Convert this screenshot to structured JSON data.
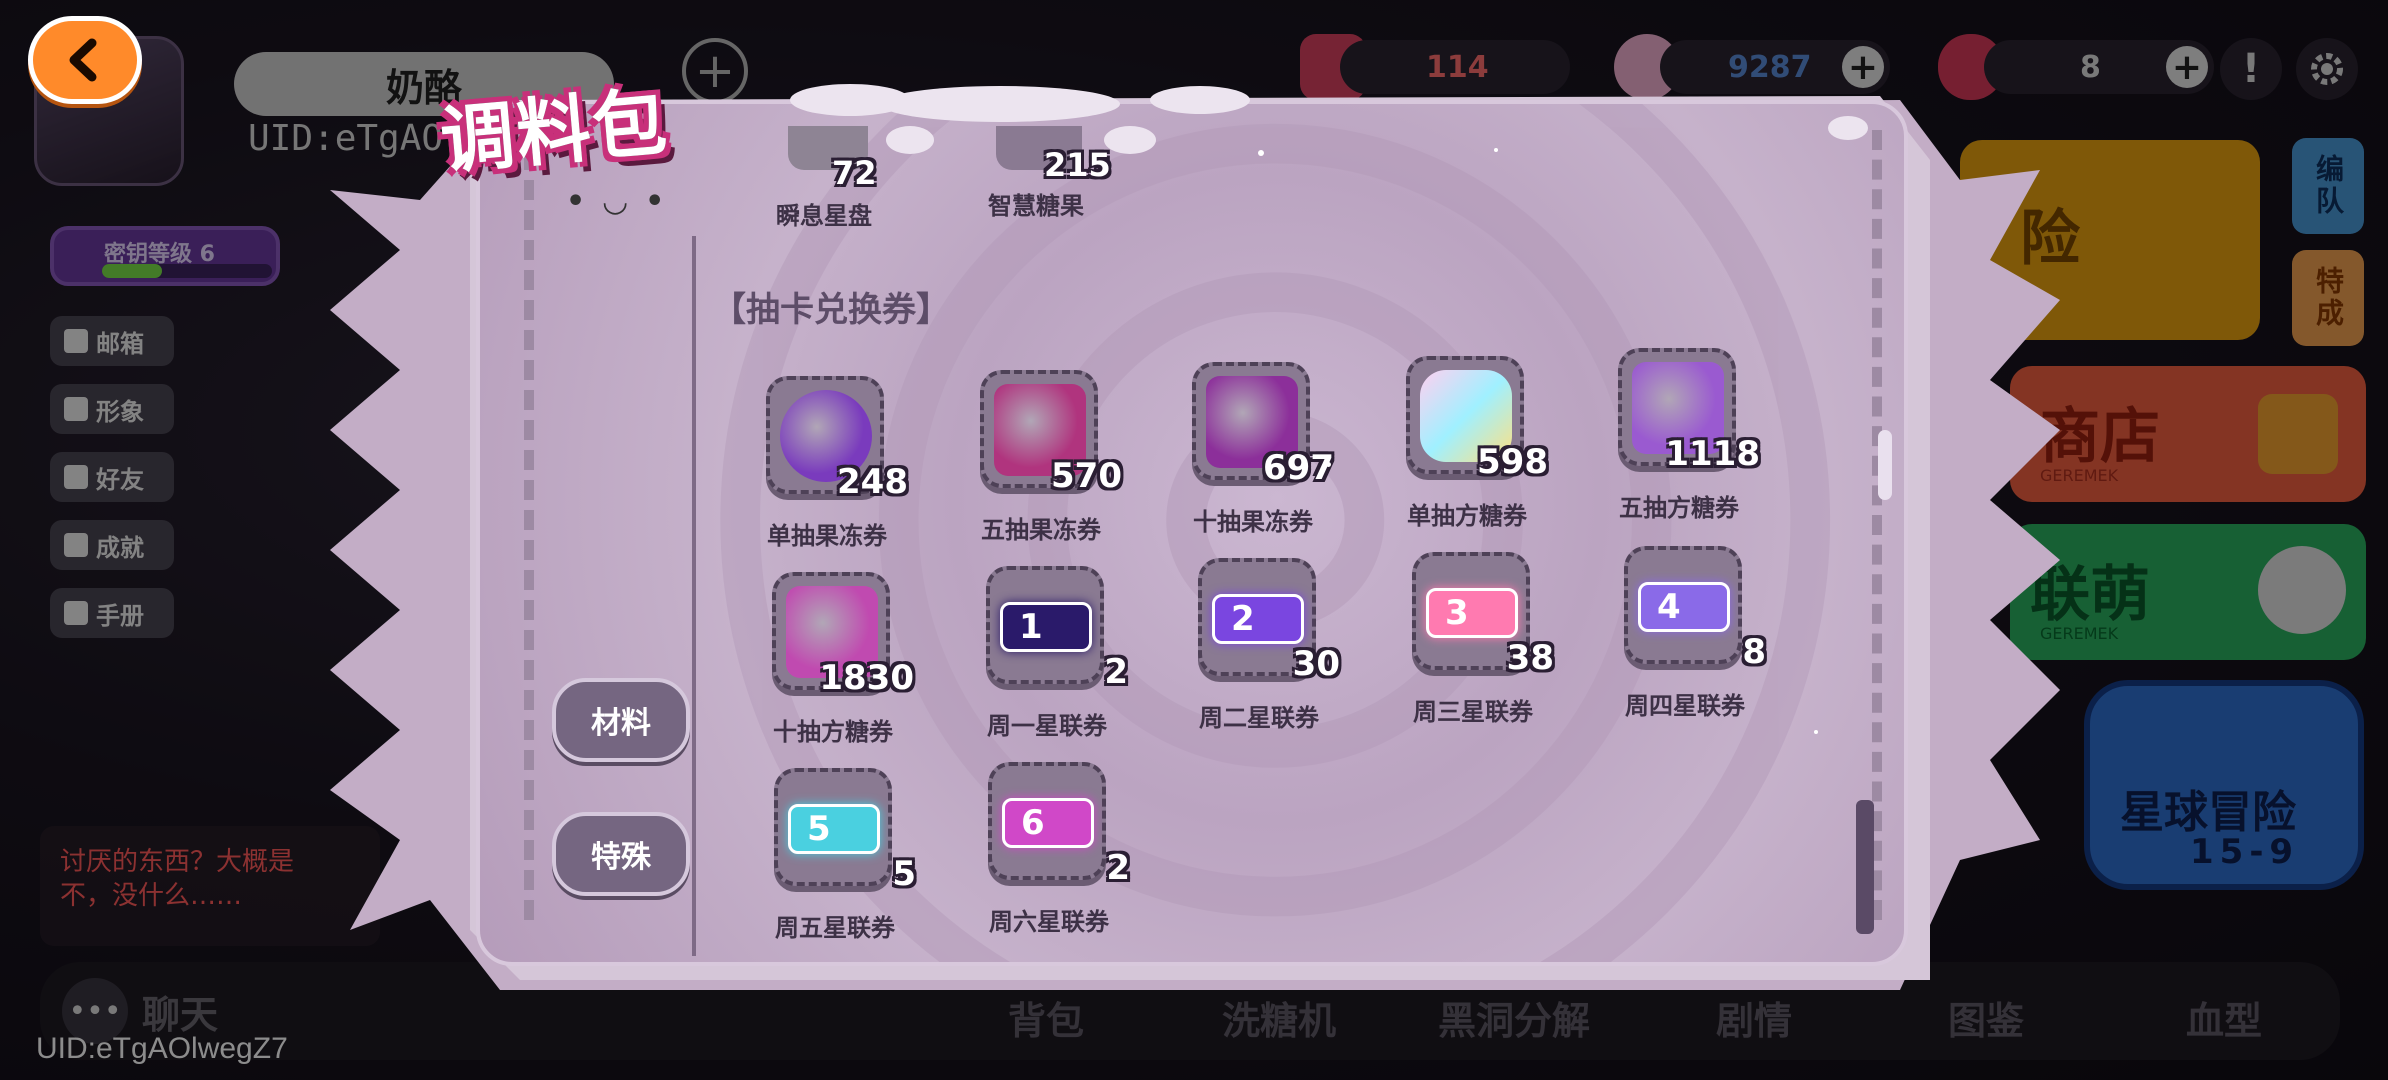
{
  "hud": {
    "player_name": "奶酪",
    "uid_short": "UID:eTgAO",
    "resource_1": "114",
    "resource_2": "9287",
    "resource_3": "8",
    "level_label": "密钥等级 6"
  },
  "side_menu": [
    {
      "label": "邮箱"
    },
    {
      "label": "形象"
    },
    {
      "label": "好友"
    },
    {
      "label": "成就"
    },
    {
      "label": "手册"
    }
  ],
  "right_menu": {
    "team": "编队",
    "special": "特成",
    "shop": "商店",
    "shop_sub": "GEREMEK",
    "union": "联萌",
    "union_sub": "GEREMEK",
    "adventure_title": "星球冒险",
    "adventure_stage": "15-9",
    "adventure_partial": "险"
  },
  "chat": {
    "message_line1": "讨厌的东西？大概是",
    "message_line2": "不，没什么……",
    "button_label": "聊天"
  },
  "uid_bottom": "UID:eTgAOlwegZ7",
  "bottom_nav": [
    "背包",
    "洗糖机",
    "黑洞分解",
    "剧情",
    "图鉴",
    "血型"
  ],
  "modal": {
    "title": "调料包",
    "face": "• ◡ •",
    "tabs": [
      {
        "label": "材料"
      },
      {
        "label": "特殊"
      }
    ],
    "top_items": [
      {
        "name": "瞬息星盘",
        "count": "72"
      },
      {
        "name": "智慧糖果",
        "count": "215"
      }
    ],
    "section_title": "【抽卡兑换券】",
    "items": [
      {
        "name": "单抽果冻券",
        "count": "248",
        "icon": "jelly-cup-icon",
        "color": "#7a3bbd"
      },
      {
        "name": "五抽果冻券",
        "count": "570",
        "icon": "jelly-bag-icon",
        "color": "#b0347e"
      },
      {
        "name": "十抽果冻券",
        "count": "697",
        "icon": "jelly-box-icon",
        "color": "#8c2f9a"
      },
      {
        "name": "单抽方糖券",
        "count": "598",
        "icon": "rainbow-cube-icon",
        "color": "#7fe0d8"
      },
      {
        "name": "五抽方糖券",
        "count": "1118",
        "icon": "cube-bag-icon",
        "color": "#9a5ad0"
      },
      {
        "name": "十抽方糖券",
        "count": "1830",
        "icon": "cube-pile-icon",
        "color": "#c04ab0"
      },
      {
        "name": "周一星联券",
        "count": "2",
        "icon": "ticket-1-icon",
        "color": "#2a1a6a",
        "num": "1"
      },
      {
        "name": "周二星联券",
        "count": "30",
        "icon": "ticket-2-icon",
        "color": "#7a46e0",
        "num": "2"
      },
      {
        "name": "周三星联券",
        "count": "38",
        "icon": "ticket-3-icon",
        "color": "#ff7ab0",
        "num": "3"
      },
      {
        "name": "周四星联券",
        "count": "8",
        "icon": "ticket-4-icon",
        "color": "#8a6ae8",
        "num": "4"
      },
      {
        "name": "周五星联券",
        "count": "5",
        "icon": "ticket-5-icon",
        "color": "#4ad0e0",
        "num": "5"
      },
      {
        "name": "周六星联券",
        "count": "2",
        "icon": "ticket-6-icon",
        "color": "#d048c8",
        "num": "6"
      }
    ]
  }
}
